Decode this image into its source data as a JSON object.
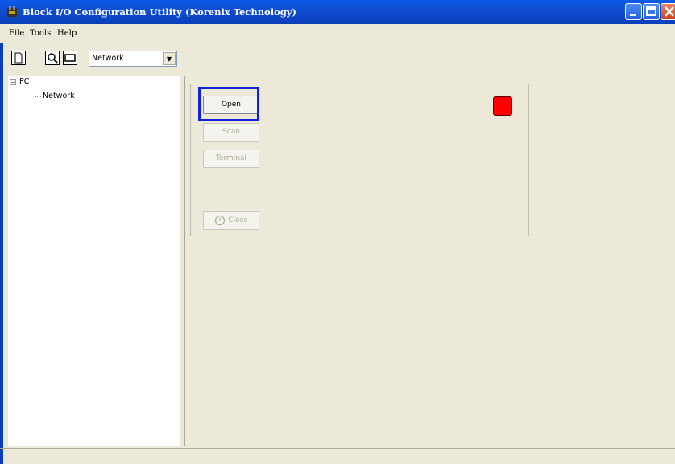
{
  "window": {
    "title": "Block I/O Configuration Utility (Korenix Technology)"
  },
  "menu": {
    "items": [
      {
        "label": "File"
      },
      {
        "label": "Tools"
      },
      {
        "label": "Help"
      }
    ]
  },
  "toolbar": {
    "combo_value": "Network",
    "icons": [
      "new-icon",
      "search-icon",
      "window-icon"
    ]
  },
  "tree": {
    "root_label": "PC",
    "child_label": "Network",
    "expander": "⊟"
  },
  "panel": {
    "open_label": "Open",
    "scan_label": "Scan",
    "terminal_label": "Terminal",
    "close_label": "Close",
    "status_color": "#ff0000"
  },
  "colors": {
    "titlebar": "#0a5ce8",
    "focus_ring": "#1020e0",
    "background": "#ece9d8"
  }
}
